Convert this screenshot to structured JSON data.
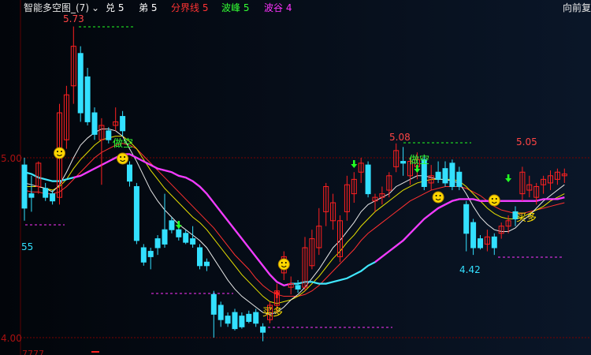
{
  "header": {
    "title": "智能多空图_(7)",
    "title_dropdown": "⌄",
    "items": [
      {
        "label": "兑 5",
        "color": "#ffffff"
      },
      {
        "label": "弟 5",
        "color": "#ffffff"
      },
      {
        "label": "分界线 5",
        "color": "#ff3333"
      },
      {
        "label": "波峰 5",
        "color": "#33ff33"
      },
      {
        "label": "波谷 4",
        "color": "#ff33ff"
      }
    ],
    "right_control": "向前复"
  },
  "axis": {
    "y_labels": [
      {
        "text": "5.00",
        "value": 5.0
      },
      {
        "text": "4.00",
        "value": 4.0
      }
    ],
    "extra_left_labels": [
      "55"
    ],
    "bottom_left_fragment": "7777"
  },
  "annotations": {
    "high_label": "5.73",
    "second_high_label": "5.08",
    "right_high_label": "5.05",
    "low_label": "4.42",
    "short_label": "做空",
    "long_label": "买多"
  },
  "colors": {
    "up": "#ff2020",
    "down": "#33e0ff",
    "ma_white": "#e8e8e8",
    "ma_yellow": "#e6e000",
    "ma_red": "#ff3030",
    "ma_cyan": "#40e8ff",
    "ma_magenta": "#ff33ff",
    "grid": "#7a0000",
    "dash_green": "#22ff22",
    "dash_magenta": "#ff33ff"
  },
  "chart_data": {
    "type": "candlestick",
    "ylim": [
      3.96,
      5.96
    ],
    "candles": [
      {
        "o": 4.96,
        "h": 5.0,
        "l": 4.65,
        "c": 4.72
      },
      {
        "o": 4.8,
        "h": 4.9,
        "l": 4.7,
        "c": 4.78
      },
      {
        "o": 4.84,
        "h": 4.98,
        "l": 4.8,
        "c": 4.97
      },
      {
        "o": 4.83,
        "h": 4.86,
        "l": 4.76,
        "c": 4.78
      },
      {
        "o": 4.8,
        "h": 4.82,
        "l": 4.74,
        "c": 4.76
      },
      {
        "o": 4.78,
        "h": 5.3,
        "l": 4.74,
        "c": 5.25
      },
      {
        "o": 5.1,
        "h": 5.4,
        "l": 5.05,
        "c": 5.35
      },
      {
        "o": 5.4,
        "h": 5.73,
        "l": 5.3,
        "c": 5.62
      },
      {
        "o": 5.58,
        "h": 5.62,
        "l": 5.2,
        "c": 5.25
      },
      {
        "o": 5.45,
        "h": 5.5,
        "l": 5.18,
        "c": 5.2
      },
      {
        "o": 5.25,
        "h": 5.28,
        "l": 5.1,
        "c": 5.13
      },
      {
        "o": 5.1,
        "h": 5.22,
        "l": 4.85,
        "c": 5.18
      },
      {
        "o": 5.15,
        "h": 5.17,
        "l": 5.08,
        "c": 5.1
      },
      {
        "o": 5.18,
        "h": 5.28,
        "l": 5.15,
        "c": 5.2
      },
      {
        "o": 5.23,
        "h": 5.26,
        "l": 5.12,
        "c": 5.15
      },
      {
        "o": 4.96,
        "h": 4.98,
        "l": 4.84,
        "c": 4.87
      },
      {
        "o": 4.84,
        "h": 4.86,
        "l": 4.52,
        "c": 4.54
      },
      {
        "o": 4.5,
        "h": 4.52,
        "l": 4.4,
        "c": 4.42
      },
      {
        "o": 4.48,
        "h": 4.5,
        "l": 4.38,
        "c": 4.45
      },
      {
        "o": 4.55,
        "h": 4.57,
        "l": 4.46,
        "c": 4.5
      },
      {
        "o": 4.6,
        "h": 4.8,
        "l": 4.5,
        "c": 4.52
      },
      {
        "o": 4.65,
        "h": 4.67,
        "l": 4.58,
        "c": 4.6
      },
      {
        "o": 4.6,
        "h": 4.62,
        "l": 4.54,
        "c": 4.56
      },
      {
        "o": 4.58,
        "h": 4.6,
        "l": 4.52,
        "c": 4.53
      },
      {
        "o": 4.55,
        "h": 4.62,
        "l": 4.5,
        "c": 4.52
      },
      {
        "o": 4.5,
        "h": 4.52,
        "l": 4.38,
        "c": 4.4
      },
      {
        "o": 4.42,
        "h": 4.44,
        "l": 4.37,
        "c": 4.4
      },
      {
        "o": 4.24,
        "h": 4.26,
        "l": 4.0,
        "c": 4.13
      },
      {
        "o": 4.18,
        "h": 4.2,
        "l": 4.06,
        "c": 4.1
      },
      {
        "o": 4.12,
        "h": 4.14,
        "l": 4.06,
        "c": 4.08
      },
      {
        "o": 4.14,
        "h": 4.16,
        "l": 4.04,
        "c": 4.05
      },
      {
        "o": 4.12,
        "h": 4.14,
        "l": 4.05,
        "c": 4.06
      },
      {
        "o": 4.13,
        "h": 4.15,
        "l": 4.08,
        "c": 4.09
      },
      {
        "o": 4.14,
        "h": 4.16,
        "l": 4.06,
        "c": 4.08
      },
      {
        "o": 4.06,
        "h": 4.08,
        "l": 3.98,
        "c": 4.03
      },
      {
        "o": 4.1,
        "h": 4.2,
        "l": 4.08,
        "c": 4.18
      },
      {
        "o": 4.18,
        "h": 4.3,
        "l": 4.14,
        "c": 4.26
      },
      {
        "o": 4.36,
        "h": 4.48,
        "l": 4.32,
        "c": 4.45
      },
      {
        "o": 4.28,
        "h": 4.34,
        "l": 4.24,
        "c": 4.3
      },
      {
        "o": 4.29,
        "h": 4.32,
        "l": 4.25,
        "c": 4.27
      },
      {
        "o": 4.28,
        "h": 4.56,
        "l": 4.26,
        "c": 4.5
      },
      {
        "o": 4.4,
        "h": 4.6,
        "l": 4.38,
        "c": 4.55
      },
      {
        "o": 4.5,
        "h": 4.72,
        "l": 4.46,
        "c": 4.62
      },
      {
        "o": 4.7,
        "h": 4.86,
        "l": 4.62,
        "c": 4.84
      },
      {
        "o": 4.65,
        "h": 4.8,
        "l": 4.6,
        "c": 4.75
      },
      {
        "o": 4.45,
        "h": 4.68,
        "l": 4.42,
        "c": 4.65
      },
      {
        "o": 4.7,
        "h": 4.9,
        "l": 4.65,
        "c": 4.85
      },
      {
        "o": 4.8,
        "h": 4.92,
        "l": 4.75,
        "c": 4.88
      },
      {
        "o": 4.92,
        "h": 5.0,
        "l": 4.86,
        "c": 4.97
      },
      {
        "o": 4.96,
        "h": 4.98,
        "l": 4.78,
        "c": 4.8
      },
      {
        "o": 4.76,
        "h": 4.8,
        "l": 4.7,
        "c": 4.78
      },
      {
        "o": 4.78,
        "h": 4.84,
        "l": 4.74,
        "c": 4.8
      },
      {
        "o": 4.82,
        "h": 4.92,
        "l": 4.78,
        "c": 4.9
      },
      {
        "o": 4.95,
        "h": 5.08,
        "l": 4.92,
        "c": 5.04
      },
      {
        "o": 4.98,
        "h": 5.06,
        "l": 4.9,
        "c": 4.97
      },
      {
        "o": 4.9,
        "h": 5.0,
        "l": 4.85,
        "c": 4.98
      },
      {
        "o": 4.95,
        "h": 5.03,
        "l": 4.88,
        "c": 4.99
      },
      {
        "o": 4.99,
        "h": 5.01,
        "l": 4.82,
        "c": 4.84
      },
      {
        "o": 4.86,
        "h": 4.96,
        "l": 4.82,
        "c": 4.9
      },
      {
        "o": 4.92,
        "h": 4.98,
        "l": 4.86,
        "c": 4.88
      },
      {
        "o": 4.94,
        "h": 4.98,
        "l": 4.84,
        "c": 4.86
      },
      {
        "o": 4.97,
        "h": 4.99,
        "l": 4.82,
        "c": 4.84
      },
      {
        "o": 4.92,
        "h": 4.95,
        "l": 4.82,
        "c": 4.84
      },
      {
        "o": 4.74,
        "h": 4.76,
        "l": 4.48,
        "c": 4.58
      },
      {
        "o": 4.64,
        "h": 4.66,
        "l": 4.46,
        "c": 4.5
      },
      {
        "o": 4.55,
        "h": 4.57,
        "l": 4.49,
        "c": 4.5
      },
      {
        "o": 4.52,
        "h": 4.6,
        "l": 4.48,
        "c": 4.56
      },
      {
        "o": 4.56,
        "h": 4.58,
        "l": 4.46,
        "c": 4.5
      },
      {
        "o": 4.58,
        "h": 4.64,
        "l": 4.55,
        "c": 4.62
      },
      {
        "o": 4.62,
        "h": 4.68,
        "l": 4.58,
        "c": 4.65
      },
      {
        "o": 4.7,
        "h": 4.73,
        "l": 4.62,
        "c": 4.66
      },
      {
        "o": 4.8,
        "h": 4.95,
        "l": 4.76,
        "c": 4.92
      },
      {
        "o": 4.82,
        "h": 4.9,
        "l": 4.78,
        "c": 4.85
      },
      {
        "o": 4.78,
        "h": 4.86,
        "l": 4.74,
        "c": 4.84
      },
      {
        "o": 4.85,
        "h": 4.9,
        "l": 4.8,
        "c": 4.88
      },
      {
        "o": 4.86,
        "h": 4.93,
        "l": 4.82,
        "c": 4.9
      },
      {
        "o": 4.88,
        "h": 4.94,
        "l": 4.85,
        "c": 4.92
      },
      {
        "o": 4.9,
        "h": 4.94,
        "l": 4.86,
        "c": 4.91
      }
    ],
    "ma_white": [
      4.86,
      4.85,
      4.84,
      4.83,
      4.81,
      4.85,
      4.92,
      5.0,
      5.07,
      5.11,
      5.14,
      5.16,
      5.16,
      5.15,
      5.12,
      5.05,
      4.98,
      4.9,
      4.82,
      4.76,
      4.71,
      4.67,
      4.63,
      4.6,
      4.57,
      4.54,
      4.5,
      4.44,
      4.38,
      4.32,
      4.27,
      4.23,
      4.2,
      4.17,
      4.14,
      4.13,
      4.14,
      4.17,
      4.21,
      4.24,
      4.28,
      4.33,
      4.38,
      4.44,
      4.5,
      4.54,
      4.59,
      4.64,
      4.7,
      4.74,
      4.76,
      4.78,
      4.8,
      4.84,
      4.86,
      4.88,
      4.9,
      4.9,
      4.89,
      4.88,
      4.88,
      4.87,
      4.86,
      4.8,
      4.73,
      4.67,
      4.63,
      4.6,
      4.59,
      4.59,
      4.61,
      4.65,
      4.68,
      4.72,
      4.76,
      4.79,
      4.82,
      4.85
    ],
    "ma_yellow": [
      4.84,
      4.84,
      4.84,
      4.83,
      4.82,
      4.84,
      4.88,
      4.94,
      4.99,
      5.03,
      5.07,
      5.1,
      5.11,
      5.12,
      5.12,
      5.09,
      5.05,
      4.99,
      4.93,
      4.88,
      4.83,
      4.79,
      4.75,
      4.71,
      4.67,
      4.64,
      4.6,
      4.55,
      4.5,
      4.45,
      4.4,
      4.35,
      4.31,
      4.27,
      4.23,
      4.2,
      4.19,
      4.2,
      4.21,
      4.23,
      4.26,
      4.3,
      4.34,
      4.39,
      4.44,
      4.48,
      4.53,
      4.57,
      4.62,
      4.66,
      4.7,
      4.73,
      4.76,
      4.79,
      4.82,
      4.84,
      4.86,
      4.87,
      4.88,
      4.88,
      4.88,
      4.88,
      4.87,
      4.84,
      4.8,
      4.76,
      4.72,
      4.69,
      4.67,
      4.66,
      4.66,
      4.67,
      4.69,
      4.71,
      4.73,
      4.76,
      4.78,
      4.8
    ],
    "ma_red": [
      4.82,
      4.81,
      4.81,
      4.8,
      4.8,
      4.81,
      4.84,
      4.88,
      4.92,
      4.96,
      5.0,
      5.03,
      5.05,
      5.07,
      5.08,
      5.07,
      5.05,
      5.01,
      4.97,
      4.93,
      4.89,
      4.85,
      4.81,
      4.77,
      4.73,
      4.69,
      4.65,
      4.61,
      4.56,
      4.51,
      4.46,
      4.42,
      4.38,
      4.33,
      4.29,
      4.26,
      4.24,
      4.23,
      4.23,
      4.23,
      4.24,
      4.26,
      4.29,
      4.33,
      4.37,
      4.41,
      4.45,
      4.49,
      4.54,
      4.58,
      4.61,
      4.64,
      4.67,
      4.7,
      4.73,
      4.76,
      4.78,
      4.8,
      4.82,
      4.83,
      4.84,
      4.84,
      4.84,
      4.83,
      4.81,
      4.79,
      4.76,
      4.73,
      4.71,
      4.7,
      4.69,
      4.69,
      4.7,
      4.71,
      4.72,
      4.73,
      4.74,
      4.75
    ],
    "ma_cyan": [
      4.92,
      4.91,
      4.89,
      4.88,
      4.87,
      4.87,
      4.88,
      4.89,
      4.9,
      4.92,
      4.94,
      4.96,
      4.98,
      5.0,
      5.02,
      5.02,
      5.0,
      4.98,
      4.96,
      4.94,
      4.93,
      4.92,
      4.9,
      4.89,
      4.87,
      4.84,
      4.8,
      4.75,
      4.7,
      4.65,
      4.6,
      4.55,
      4.5,
      4.45,
      4.4,
      4.35,
      4.31,
      4.29,
      4.3,
      4.3,
      4.31,
      4.31,
      4.3,
      4.3,
      4.31,
      4.32,
      4.33,
      4.35,
      4.37,
      4.4,
      4.42,
      4.45,
      4.48,
      4.51,
      4.54,
      4.58,
      4.62,
      4.66,
      4.69,
      4.72,
      4.74,
      4.76,
      4.77,
      4.77,
      4.77,
      4.76,
      4.76,
      4.76,
      4.76,
      4.76,
      4.76,
      4.76,
      4.76,
      4.76,
      4.77,
      4.77,
      4.77,
      4.78
    ],
    "ma_magenta": [
      4.92,
      4.91,
      4.89,
      4.88,
      4.87,
      4.87,
      4.88,
      4.89,
      4.9,
      4.92,
      4.94,
      4.96,
      4.98,
      5.0,
      5.02,
      5.02,
      5.0,
      4.98,
      4.96,
      4.94,
      4.93,
      4.92,
      4.9,
      4.89,
      4.87,
      4.84,
      4.8,
      4.75,
      4.7,
      4.65,
      4.6,
      4.55,
      4.5,
      4.45,
      4.4,
      4.35,
      4.31,
      4.29,
      4.3,
      4.3,
      4.31,
      4.31,
      4.3,
      4.3,
      4.31,
      4.32,
      4.33,
      4.35,
      4.37,
      4.4,
      4.42,
      4.45,
      4.48,
      4.51,
      4.54,
      4.58,
      4.62,
      4.66,
      4.69,
      4.72,
      4.74,
      4.76,
      4.77,
      4.77,
      4.77,
      4.76,
      4.76,
      4.76,
      4.76,
      4.76,
      4.76,
      4.76,
      4.76,
      4.76,
      4.77,
      4.77,
      4.77,
      4.78
    ],
    "magenta_from_index": 7,
    "magenta_to_index": 38,
    "cyan_from_index": 0,
    "cyan_to_index": 78,
    "signals": {
      "smiley_indices": [
        5,
        14,
        37,
        59,
        67
      ],
      "short_indices": [
        13,
        52
      ],
      "long_indices": [
        32,
        66
      ],
      "green_down_arrow_indices": [
        22,
        47,
        56,
        69
      ],
      "red_up_arrow_index": 36
    }
  }
}
